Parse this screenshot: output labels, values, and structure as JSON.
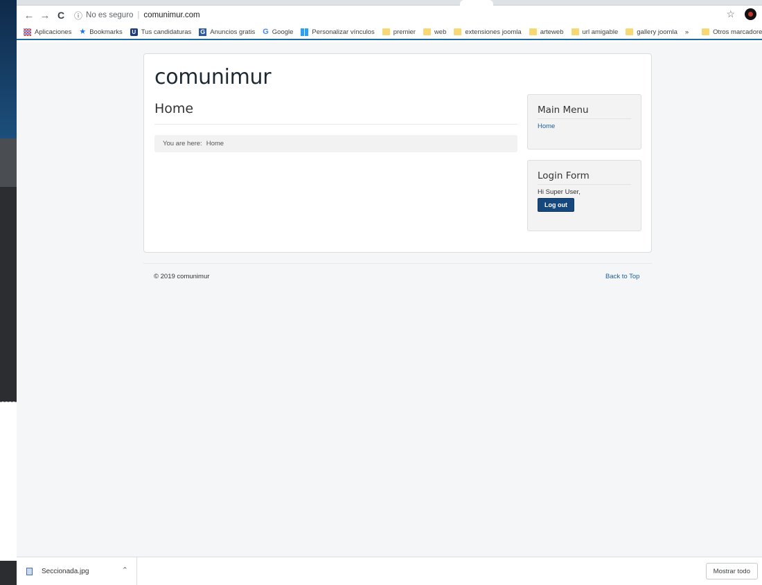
{
  "browser": {
    "security_label": "No es seguro",
    "url": "comunimur.com"
  },
  "bookmarks": {
    "items": [
      "Aplicaciones",
      "Bookmarks",
      "Tus candidaturas",
      "Anuncios gratis",
      "Google",
      "Personalizar vínculos",
      "premier",
      "web",
      "extensiones joomla",
      "arteweb",
      "url amigable",
      "gallery joomla"
    ],
    "overflow": "»",
    "other": "Otros marcadores"
  },
  "site": {
    "title": "comunimur",
    "page_heading": "Home",
    "breadcrumb_prefix": "You are here:",
    "breadcrumb_current": "Home"
  },
  "main_menu": {
    "title": "Main Menu",
    "items": [
      "Home"
    ]
  },
  "login_form": {
    "title": "Login Form",
    "greeting": "Hi Super User,",
    "logout_label": "Log out"
  },
  "footer": {
    "copyright": "© 2019 comunimur",
    "back_to_top": "Back to Top"
  },
  "downloads": {
    "file_name": "Seccionada.jpg",
    "show_all_label": "Mostrar todo"
  },
  "colors": {
    "accent": "#1b6ba1",
    "link": "#1b5e9a",
    "button": "#16477d",
    "page_bg": "#f4f6f7"
  },
  "icons": {
    "back": "back-arrow-icon",
    "forward": "forward-arrow-icon",
    "reload": "reload-icon",
    "info": "info-icon",
    "star": "star-icon",
    "profile": "profile-avatar-icon",
    "download_file": "image-file-icon",
    "caret": "chevron-up-icon"
  }
}
